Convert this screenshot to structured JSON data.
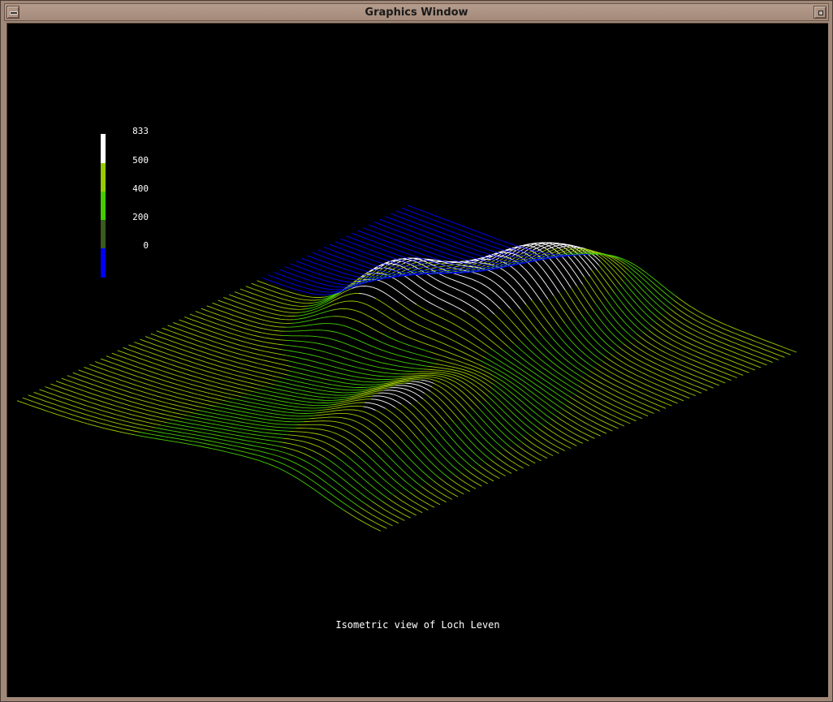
{
  "window": {
    "title": "Graphics Window",
    "icons": {
      "menu": "window-menu-icon",
      "maximize": "maximize-icon"
    }
  },
  "legend": {
    "labels": [
      "833",
      "500",
      "400",
      "200",
      "0"
    ],
    "colors": [
      "#ffffff",
      "#99cc00",
      "#44cc00",
      "#3a5a1e",
      "#0000ff"
    ]
  },
  "caption": "Isometric view of Loch Leven",
  "colors": {
    "background": "#000000",
    "water": "#0000ff",
    "low": "#3a5a1e",
    "mid": "#44cc00",
    "high": "#99cc00",
    "peak": "#ffffff"
  }
}
